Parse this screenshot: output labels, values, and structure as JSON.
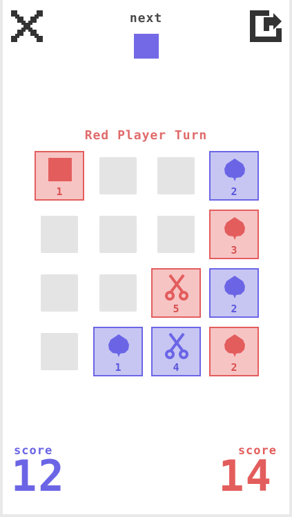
{
  "header": {
    "next_label": "next",
    "next_color": "#7369e6",
    "close_icon": "close-x-icon",
    "share_icon": "share-arrow-icon"
  },
  "status": {
    "turn_text": "Red Player Turn",
    "turn_color": "#e06b6b"
  },
  "colors": {
    "red": "#e35d5d",
    "red_fill": "#f7c4c4",
    "blue": "#6b65e6",
    "blue_fill": "#c7c6f2",
    "empty": "#e4e4e4"
  },
  "board": {
    "rows": 4,
    "cols": 4,
    "cells": [
      {
        "row": 0,
        "col": 0,
        "state": "card",
        "owner": "red",
        "icon": "square",
        "value": "1"
      },
      {
        "row": 0,
        "col": 1,
        "state": "empty"
      },
      {
        "row": 0,
        "col": 2,
        "state": "empty"
      },
      {
        "row": 0,
        "col": 3,
        "state": "card",
        "owner": "blue",
        "icon": "rock",
        "value": "2"
      },
      {
        "row": 1,
        "col": 0,
        "state": "empty"
      },
      {
        "row": 1,
        "col": 1,
        "state": "empty"
      },
      {
        "row": 1,
        "col": 2,
        "state": "empty"
      },
      {
        "row": 1,
        "col": 3,
        "state": "card",
        "owner": "red",
        "icon": "rock",
        "value": "3"
      },
      {
        "row": 2,
        "col": 0,
        "state": "empty"
      },
      {
        "row": 2,
        "col": 1,
        "state": "empty"
      },
      {
        "row": 2,
        "col": 2,
        "state": "card",
        "owner": "red",
        "icon": "scissors",
        "value": "5"
      },
      {
        "row": 2,
        "col": 3,
        "state": "card",
        "owner": "blue",
        "icon": "rock",
        "value": "2"
      },
      {
        "row": 3,
        "col": 0,
        "state": "empty"
      },
      {
        "row": 3,
        "col": 1,
        "state": "card",
        "owner": "blue",
        "icon": "rock",
        "value": "1"
      },
      {
        "row": 3,
        "col": 2,
        "state": "card",
        "owner": "blue",
        "icon": "scissors",
        "value": "4"
      },
      {
        "row": 3,
        "col": 3,
        "state": "card",
        "owner": "red",
        "icon": "rock",
        "value": "2"
      }
    ]
  },
  "scores": {
    "blue": {
      "label": "score",
      "value": "12",
      "color": "#6b65e6"
    },
    "red": {
      "label": "score",
      "value": "14",
      "color": "#e35d5d"
    }
  }
}
